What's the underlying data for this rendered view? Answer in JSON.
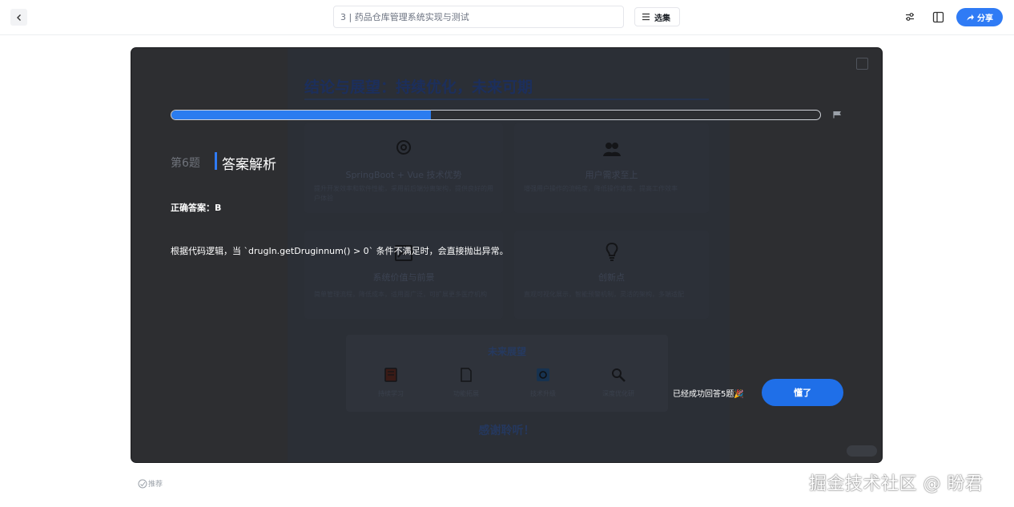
{
  "topbar": {
    "doc_title": "3 | 药品仓库管理系统实现与测试",
    "select_label": "选集",
    "share_label": "分享",
    "icons": [
      "back-icon",
      "filter-icon",
      "split-view-icon",
      "share-icon"
    ]
  },
  "slide": {
    "title": "结论与展望：持续优化，未来可期",
    "cards": [
      {
        "title": "SpringBoot + Vue 技术优势",
        "text": "提升开发效率和软件性能，采用前后端分离架构，提供良好的用户体验",
        "icon": "gear-icon"
      },
      {
        "title": "用户需求至上",
        "text": "增强用户操作的流畅度，降低操作难度，提高工作效率",
        "icon": "users-icon"
      },
      {
        "title": "系统价值与前景",
        "text": "简单管理流程，降低成本，适用面广泛，可扩展更多医疗机构",
        "icon": "chart-icon"
      },
      {
        "title": "创新点",
        "text": "直观可视化展示，智能预警机制，灵活的架构，多端适配",
        "icon": "lightbulb-icon"
      }
    ],
    "future": {
      "title": "未来展望",
      "items": [
        {
          "label": "持续学习",
          "icon": "book-icon"
        },
        {
          "label": "功能拓展",
          "icon": "document-icon"
        },
        {
          "label": "技术升级",
          "icon": "refresh-icon"
        },
        {
          "label": "深度优化研",
          "icon": "search-icon"
        }
      ]
    },
    "thanks": "感谢聆听！"
  },
  "quiz": {
    "progress": 0.4,
    "question_number": "第6题",
    "answer_title": "答案解析",
    "correct_answer": "正确答案：B",
    "explanation": "根据代码逻辑，当 `drugIn.getDruginnum() > 0` 条件不满足时，会直接抛出异常。",
    "success_text": "已经成功回答5题🎉",
    "ok_label": "懂了"
  },
  "footer": {
    "recommend_label": "推荐",
    "watermark": "掘金技术社区 @ 盼君"
  },
  "colors": {
    "accent": "#2f7bf5",
    "overlay": "#2d2e31"
  }
}
